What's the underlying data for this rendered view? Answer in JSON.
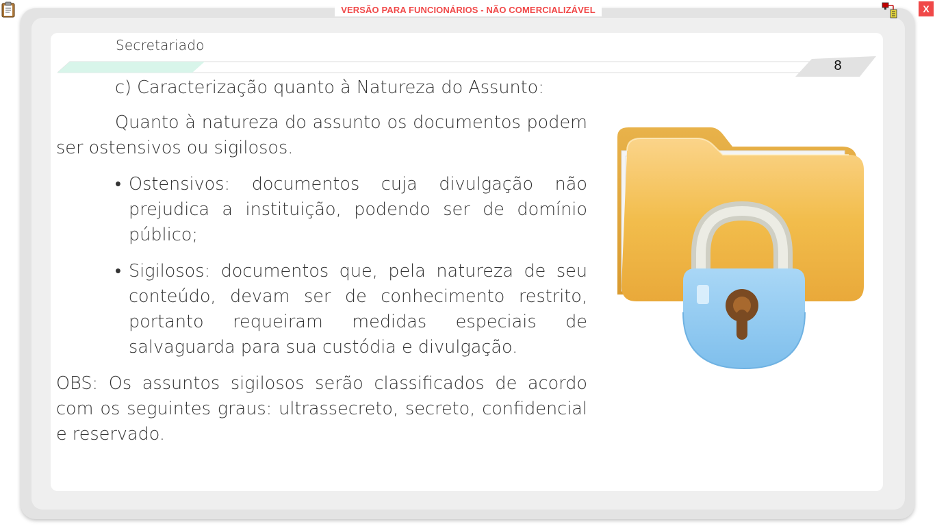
{
  "window": {
    "watermark": "VERSÃO PARA FUNCIONÁRIOS - NÃO COMERCIALIZÁVEL",
    "close_label": "X",
    "clipboard_icon": "clipboard-icon",
    "network_icon": "network-status-icon"
  },
  "header": {
    "section": "Secretariado",
    "page_number": "8"
  },
  "content": {
    "subtitle": "c) Caracterização quanto à Natureza do Assunto:",
    "intro": "Quanto à natureza do assunto os documentos podem ser ostensivos ou sigilosos.",
    "bullet_symbol": "•",
    "bullets": [
      {
        "text": "Ostensivos: documentos cuja divulgação não prejudica a instituição, podendo ser de domínio público;"
      },
      {
        "text": "Sigilosos: documentos que, pela natureza de seu conteúdo, devam ser de conhecimento restrito, portanto requeiram medidas especiais de salvaguarda para sua custódia e divulgação."
      }
    ],
    "obs": "OBS: Os assuntos sigilosos serão classificados de acordo com os seguintes graus: ultrassecreto, secreto, confidencial e reservado."
  },
  "illustration": {
    "icon": "locked-folder-icon",
    "colors": {
      "folder": "#f0b94a",
      "lock_body": "#8ec8ef",
      "shackle": "#d8d8cf",
      "keyhole": "#7a4a22"
    }
  },
  "colors": {
    "watermark_text": "#f04848",
    "close_button": "#f04848",
    "header_accent": "#d8f5ea",
    "frame": "#e3e3e3"
  }
}
